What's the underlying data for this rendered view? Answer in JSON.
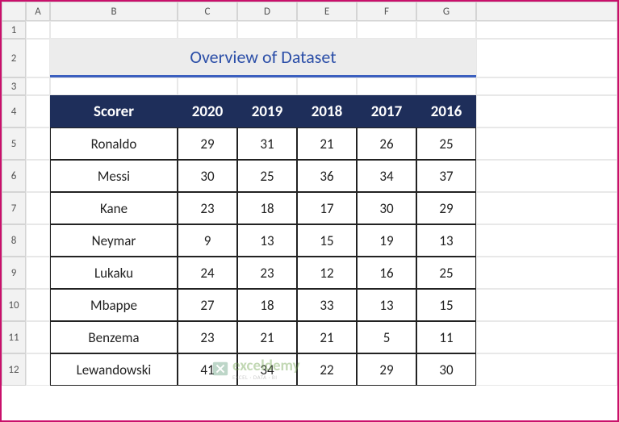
{
  "columns": [
    "",
    "A",
    "B",
    "C",
    "D",
    "E",
    "F",
    "G"
  ],
  "rows": [
    "1",
    "2",
    "3",
    "4",
    "5",
    "6",
    "7",
    "8",
    "9",
    "10",
    "11",
    "12"
  ],
  "title": "Overview of Dataset",
  "headers": [
    "Scorer",
    "2020",
    "2019",
    "2018",
    "2017",
    "2016"
  ],
  "chart_data": {
    "type": "table",
    "title": "Overview of Dataset",
    "categories": [
      "2020",
      "2019",
      "2018",
      "2017",
      "2016"
    ],
    "series": [
      {
        "name": "Ronaldo",
        "values": [
          29,
          31,
          21,
          26,
          25
        ]
      },
      {
        "name": "Messi",
        "values": [
          30,
          25,
          36,
          34,
          37
        ]
      },
      {
        "name": "Kane",
        "values": [
          23,
          18,
          17,
          30,
          29
        ]
      },
      {
        "name": "Neymar",
        "values": [
          9,
          13,
          15,
          19,
          13
        ]
      },
      {
        "name": "Lukaku",
        "values": [
          24,
          23,
          12,
          16,
          25
        ]
      },
      {
        "name": "Mbappe",
        "values": [
          27,
          18,
          33,
          13,
          15
        ]
      },
      {
        "name": "Benzema",
        "values": [
          23,
          21,
          21,
          5,
          11
        ]
      },
      {
        "name": "Lewandowski",
        "values": [
          41,
          34,
          22,
          29,
          30
        ]
      }
    ]
  },
  "watermark": {
    "brand": "exceldemy",
    "tag": "EXCEL · DATA · BI"
  }
}
